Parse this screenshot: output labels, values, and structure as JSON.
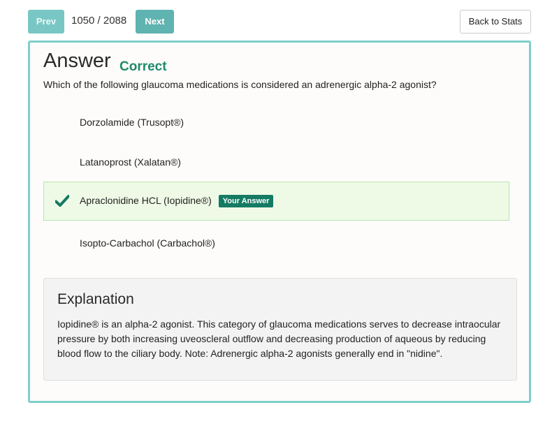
{
  "nav": {
    "prev_label": "Prev",
    "counter": "1050 / 2088",
    "next_label": "Next",
    "back_label": "Back to Stats"
  },
  "answer": {
    "heading": "Answer",
    "result": "Correct",
    "question": "Which of the following glaucoma medications is considered an adrenergic alpha-2 agonist?",
    "options": [
      {
        "label": "Dorzolamide (Trusopt®)"
      },
      {
        "label": "Latanoprost (Xalatan®)"
      },
      {
        "label": "Apraclonidine HCL (Iopidine®)",
        "badge": "Your Answer",
        "icon": "checkmark-icon"
      },
      {
        "label": "Isopto-Carbachol (Carbachol®)"
      }
    ]
  },
  "explanation": {
    "title": "Explanation",
    "body": "Iopidine® is an alpha-2 agonist. This category of glaucoma medications serves to decrease intraocular pressure by both increasing uveoscleral outflow and decreasing production of aqueous by reducing blood flow to the ciliary body. Note: Adrenergic alpha-2 agonists generally end in \"nidine\"."
  },
  "colors": {
    "accent_teal": "#7ecfca",
    "correct_green": "#1f8a6b",
    "badge_green": "#157a63",
    "selected_bg": "#eefae6"
  }
}
